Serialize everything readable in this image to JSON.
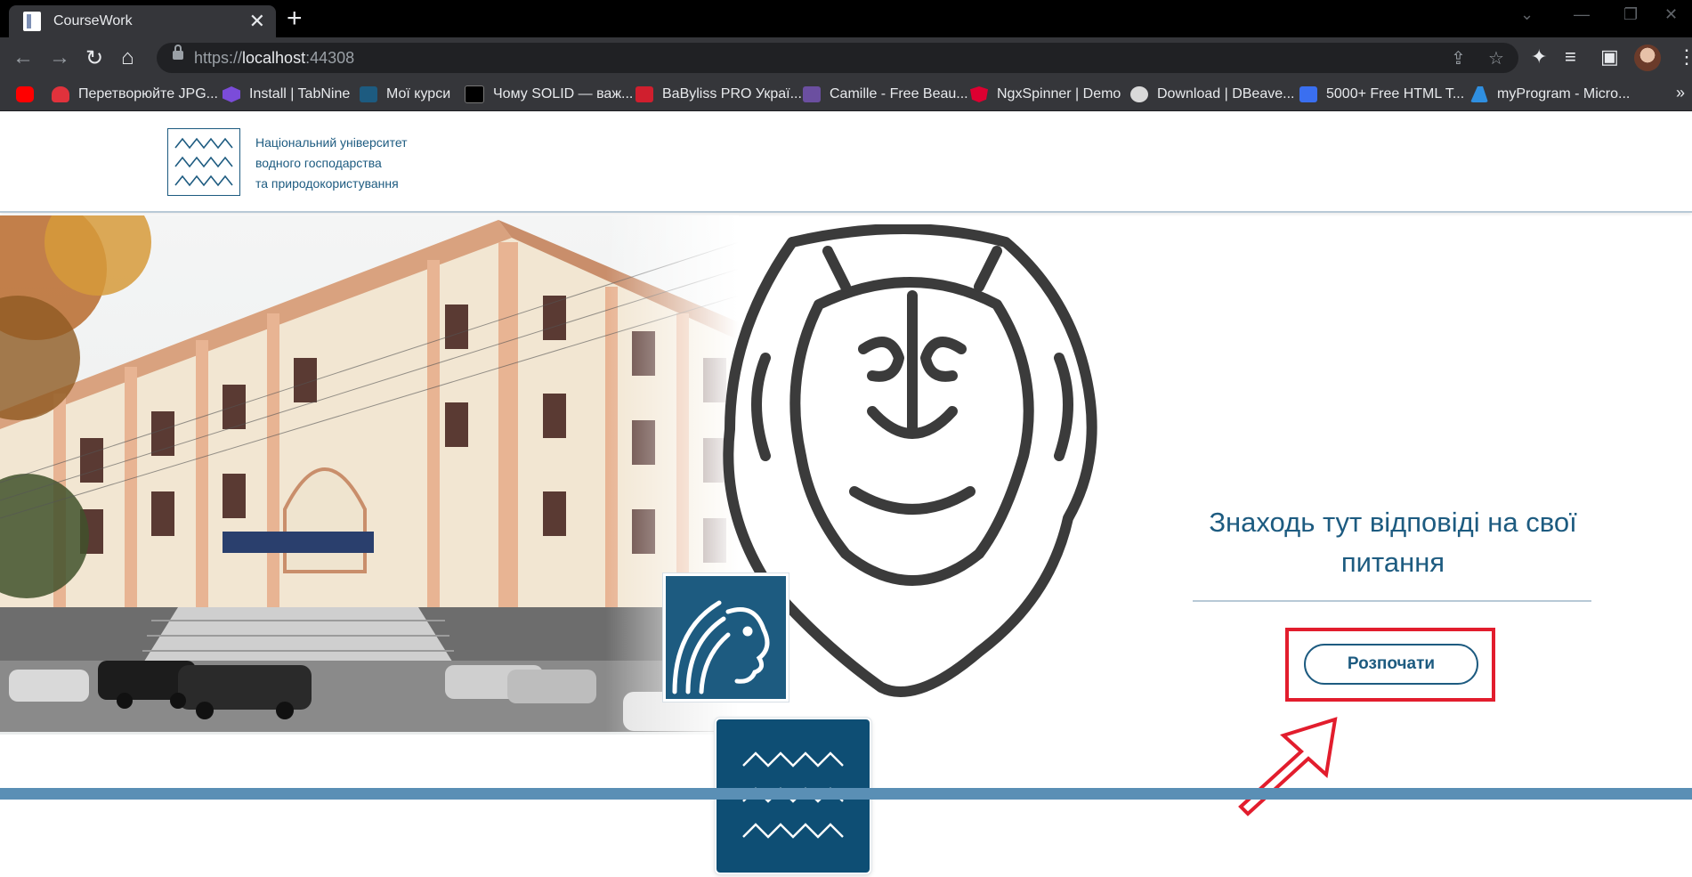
{
  "browser": {
    "tab_title": "CourseWork",
    "url_scheme": "https://",
    "url_host": "localhost",
    "url_port": ":44308",
    "bookmarks": [
      {
        "label": "",
        "icon": "youtube-icon",
        "color": "#ff0000"
      },
      {
        "label": "Перетворюйте JPG...",
        "icon": "heart-icon",
        "color": "#e0323c"
      },
      {
        "label": "Install | TabNine",
        "icon": "tabnine-icon",
        "color": "#7b4cd9"
      },
      {
        "label": "Мої курси",
        "icon": "moodle-icon",
        "color": "#1d5b80"
      },
      {
        "label": "Чому SOLID — важ...",
        "icon": "dou-icon",
        "color": "#000000"
      },
      {
        "label": "BaByliss PRO Украї...",
        "icon": "babyliss-icon",
        "color": "#d01f2e"
      },
      {
        "label": "Camille - Free Beau...",
        "icon": "colorlib-icon",
        "color": "#6b4fa0"
      },
      {
        "label": "NgxSpinner | Demo",
        "icon": "angular-icon",
        "color": "#dd0031"
      },
      {
        "label": "Download | DBeave...",
        "icon": "dbeaver-icon",
        "color": "#d9d9d9"
      },
      {
        "label": "5000+ Free HTML T...",
        "icon": "nicepage-icon",
        "color": "#3a6ff0"
      },
      {
        "label": "myProgram - Micro...",
        "icon": "azure-icon",
        "color": "#2f8fe0"
      }
    ]
  },
  "site": {
    "logo_lines": [
      "Національний університет",
      "водного господарства",
      "та природокористування"
    ],
    "headline": "Знаходь тут відповіді на свої питання",
    "start_button": "Розпочати"
  },
  "colors": {
    "brand": "#1d5b80",
    "brand_dark": "#0e4e74",
    "highlight": "#e21d2d",
    "footer": "#5a8fb5"
  }
}
